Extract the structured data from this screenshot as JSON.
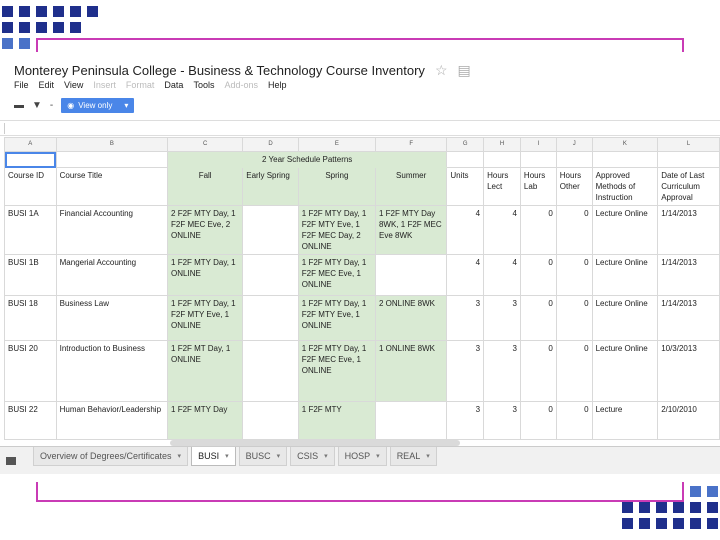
{
  "doc_title": "Monterey Peninsula College - Business & Technology Course Inventory",
  "menus": [
    {
      "label": "File",
      "enabled": true
    },
    {
      "label": "Edit",
      "enabled": true
    },
    {
      "label": "View",
      "enabled": true
    },
    {
      "label": "Insert",
      "enabled": false
    },
    {
      "label": "Format",
      "enabled": false
    },
    {
      "label": "Data",
      "enabled": true
    },
    {
      "label": "Tools",
      "enabled": true
    },
    {
      "label": "Add-ons",
      "enabled": false
    },
    {
      "label": "Help",
      "enabled": true
    }
  ],
  "toolbar": {
    "view_only_label": "View only",
    "dropdown_dash": "-",
    "dropdown_caret": "▾"
  },
  "icons": {
    "star": "star-icon",
    "folder": "folder-icon",
    "print": "print-icon",
    "filter": "filter-icon",
    "eye": "eye-icon"
  },
  "columns": [
    "A",
    "B",
    "C",
    "D",
    "E",
    "F",
    "G",
    "H",
    "I",
    "J",
    "K",
    "L"
  ],
  "group_header": "2 Year Schedule Patterns",
  "headers": {
    "course_id": "Course ID",
    "course_title": "Course Title",
    "fall": "Fall",
    "early_spring": "Early Spring",
    "spring": "Spring",
    "summer": "Summer",
    "units": "Units",
    "hours_lect": "Hours Lect",
    "hours_lab": "Hours Lab",
    "hours_other": "Hours Other",
    "approved_methods": "Approved Methods of Instruction",
    "date_last": "Date of Last Curriculum Approval"
  },
  "rows": [
    {
      "id": "BUSI 1A",
      "title": "Financial Accounting",
      "fall": "2 F2F MTY Day, 1 F2F MEC Eve, 2 ONLINE",
      "early_spring": "",
      "spring": "1 F2F MTY Day, 1 F2F MTY Eve, 1 F2F MEC Day, 2 ONLINE",
      "summer": "1 F2F MTY Day 8WK, 1 F2F MEC Eve 8WK",
      "units": "4",
      "lect": "4",
      "lab": "0",
      "other": "0",
      "methods": "Lecture Online",
      "date": "1/14/2013"
    },
    {
      "id": "BUSI 1B",
      "title": "Mangerial Accounting",
      "fall": "1 F2F MTY Day, 1 ONLINE",
      "early_spring": "",
      "spring": "1 F2F MTY Day, 1 F2F MEC Eve, 1 ONLINE",
      "summer": "",
      "units": "4",
      "lect": "4",
      "lab": "0",
      "other": "0",
      "methods": "Lecture Online",
      "date": "1/14/2013"
    },
    {
      "id": "BUSI 18",
      "title": "Business Law",
      "fall": "1 F2F MTY Day, 1 F2F MTY Eve, 1 ONLINE",
      "early_spring": "",
      "spring": "1 F2F MTY Day, 1 F2F MTY Eve, 1 ONLINE",
      "summer": "2 ONLINE 8WK",
      "units": "3",
      "lect": "3",
      "lab": "0",
      "other": "0",
      "methods": "Lecture Online",
      "date": "1/14/2013"
    },
    {
      "id": "BUSI 20",
      "title": "Introduction to Business",
      "fall": "1 F2F MT Day, 1 ONLINE",
      "early_spring": "",
      "spring": "1 F2F MTY Day, 1 F2F MEC Eve, 1 ONLINE",
      "summer": "1 ONLINE 8WK",
      "units": "3",
      "lect": "3",
      "lab": "0",
      "other": "0",
      "methods": "Lecture Online",
      "date": "10/3/2013"
    },
    {
      "id": "BUSI 22",
      "title": "Human Behavior/Leadership",
      "fall": "1 F2F MTY Day",
      "early_spring": "",
      "spring": "1 F2F MTY",
      "summer": "",
      "units": "3",
      "lect": "3",
      "lab": "0",
      "other": "0",
      "methods": "Lecture",
      "date": "2/10/2010"
    }
  ],
  "tabs": [
    {
      "label": "Overview of Degrees/Certificates",
      "active": false
    },
    {
      "label": "BUSI",
      "active": true
    },
    {
      "label": "BUSC",
      "active": false
    },
    {
      "label": "CSIS",
      "active": false
    },
    {
      "label": "HOSP",
      "active": false
    },
    {
      "label": "REAL",
      "active": false
    }
  ],
  "colors": {
    "accent": "#4a86e8",
    "schedule_fill": "#d9ead3",
    "deco_square": "#1f2f8c",
    "deco_bracket": "#c93bb5"
  }
}
